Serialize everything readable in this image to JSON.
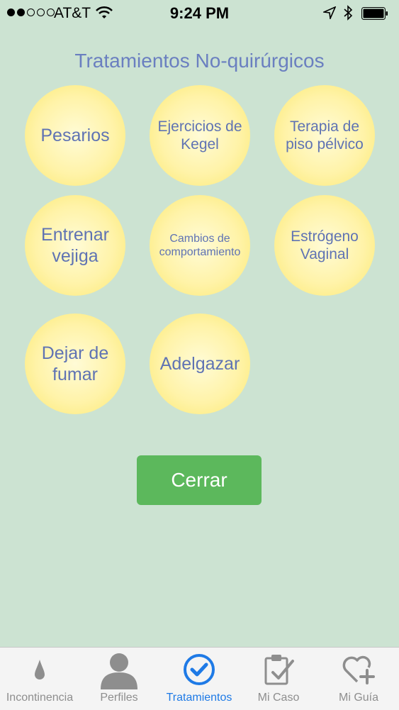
{
  "status": {
    "carrier": "AT&T",
    "time": "9:24 PM"
  },
  "title": "Tratamientos No-quirúrgicos",
  "treatments": [
    {
      "label": "Pesarios"
    },
    {
      "label": "Ejercicios de Kegel"
    },
    {
      "label": "Terapia de piso pélvico"
    },
    {
      "label": "Entrenar vejiga"
    },
    {
      "label": "Cambios de comportamiento"
    },
    {
      "label": "Estrógeno Vaginal"
    },
    {
      "label": "Dejar de fumar"
    },
    {
      "label": "Adelgazar"
    }
  ],
  "close_button": "Cerrar",
  "tabs": [
    {
      "label": "Incontinencia",
      "icon": "drop-icon"
    },
    {
      "label": "Perfiles",
      "icon": "person-icon"
    },
    {
      "label": "Tratamientos",
      "icon": "check-circle-icon",
      "active": true
    },
    {
      "label": "Mi Caso",
      "icon": "clipboard-check-icon"
    },
    {
      "label": "Mi Guía",
      "icon": "heart-plus-icon"
    }
  ],
  "colors": {
    "background": "#cce3d2",
    "title": "#6a7fc0",
    "circle_text": "#5f73b3",
    "button": "#5cb85c",
    "tab_active": "#1e7ae6",
    "tab_inactive": "#8e8e8e"
  }
}
